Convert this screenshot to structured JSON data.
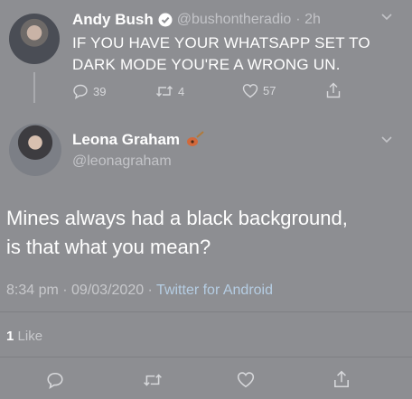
{
  "tweet_reply_to": {
    "display_name": "Andy Bush",
    "handle": "@bushontheradio",
    "time": "· 2h",
    "text_line1": "IF YOU HAVE YOUR WHATSAPP SET TO",
    "text_line2": "DARK MODE YOU'RE A WRONG UN.",
    "replies": "39",
    "retweets": "4",
    "likes": "57"
  },
  "tweet_main": {
    "display_name": "Leona Graham",
    "handle": "@leonagraham",
    "text_line1": "Mines always had a black background,",
    "text_line2": "is that what you mean?",
    "timestamp": "8:34 pm · 09/03/2020 · ",
    "source": "Twitter for Android",
    "like_count": "1",
    "like_label": "Like"
  },
  "icons": [
    "verified-badge",
    "guitar-emoji",
    "chevron-down",
    "reply",
    "retweet",
    "like",
    "share"
  ],
  "colors": {
    "background": "#8d8e92",
    "link": "#b5cde3"
  }
}
